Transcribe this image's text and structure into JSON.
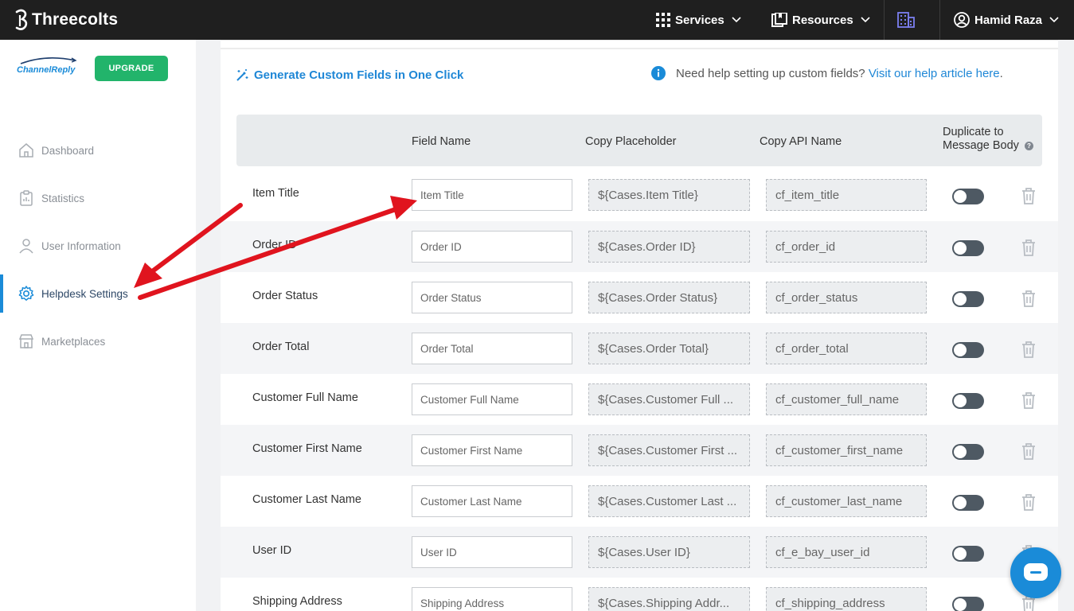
{
  "topbar": {
    "brand": "Threecolts",
    "services": "Services",
    "resources": "Resources",
    "user": "Hamid Raza"
  },
  "sidebar": {
    "logo_text": "ChannelReply",
    "upgrade": "UPGRADE",
    "items": [
      {
        "label": "Dashboard",
        "icon": "home-icon"
      },
      {
        "label": "Statistics",
        "icon": "clipboard-icon"
      },
      {
        "label": "User Information",
        "icon": "user-icon"
      },
      {
        "label": "Helpdesk Settings",
        "icon": "gear-icon",
        "active": true
      },
      {
        "label": "Marketplaces",
        "icon": "store-icon"
      }
    ]
  },
  "main": {
    "generate_link": "Generate Custom Fields in One Click",
    "help_text": "Need help setting up custom fields?",
    "help_link": "Visit our help article here",
    "help_end": ".",
    "headers": {
      "field_name": "Field Name",
      "copy_placeholder": "Copy Placeholder",
      "copy_api": "Copy API Name",
      "duplicate": "Duplicate to Message Body"
    },
    "rows": [
      {
        "name": "Item Title",
        "field": "Item Title",
        "placeholder": "${Cases.Item Title}",
        "api": "cf_item_title"
      },
      {
        "name": "Order ID",
        "field": "Order ID",
        "placeholder": "${Cases.Order ID}",
        "api": "cf_order_id"
      },
      {
        "name": "Order Status",
        "field": "Order Status",
        "placeholder": "${Cases.Order Status}",
        "api": "cf_order_status"
      },
      {
        "name": "Order Total",
        "field": "Order Total",
        "placeholder": "${Cases.Order Total}",
        "api": "cf_order_total"
      },
      {
        "name": "Customer Full Name",
        "field": "Customer Full Name",
        "placeholder": "${Cases.Customer Full ...",
        "api": "cf_customer_full_name"
      },
      {
        "name": "Customer First Name",
        "field": "Customer First Name",
        "placeholder": "${Cases.Customer First ...",
        "api": "cf_customer_first_name"
      },
      {
        "name": "Customer Last Name",
        "field": "Customer Last Name",
        "placeholder": "${Cases.Customer Last ...",
        "api": "cf_customer_last_name"
      },
      {
        "name": "User ID",
        "field": "User ID",
        "placeholder": "${Cases.User ID}",
        "api": "cf_e_bay_user_id"
      },
      {
        "name": "Shipping Address",
        "field": "Shipping Address",
        "placeholder": "${Cases.Shipping Addr...",
        "api": "cf_shipping_address"
      }
    ]
  },
  "colors": {
    "topbar": "#1f1f1f",
    "accent": "#1a8bd8",
    "upgrade": "#22b46b",
    "arrow": "#e0141e"
  }
}
